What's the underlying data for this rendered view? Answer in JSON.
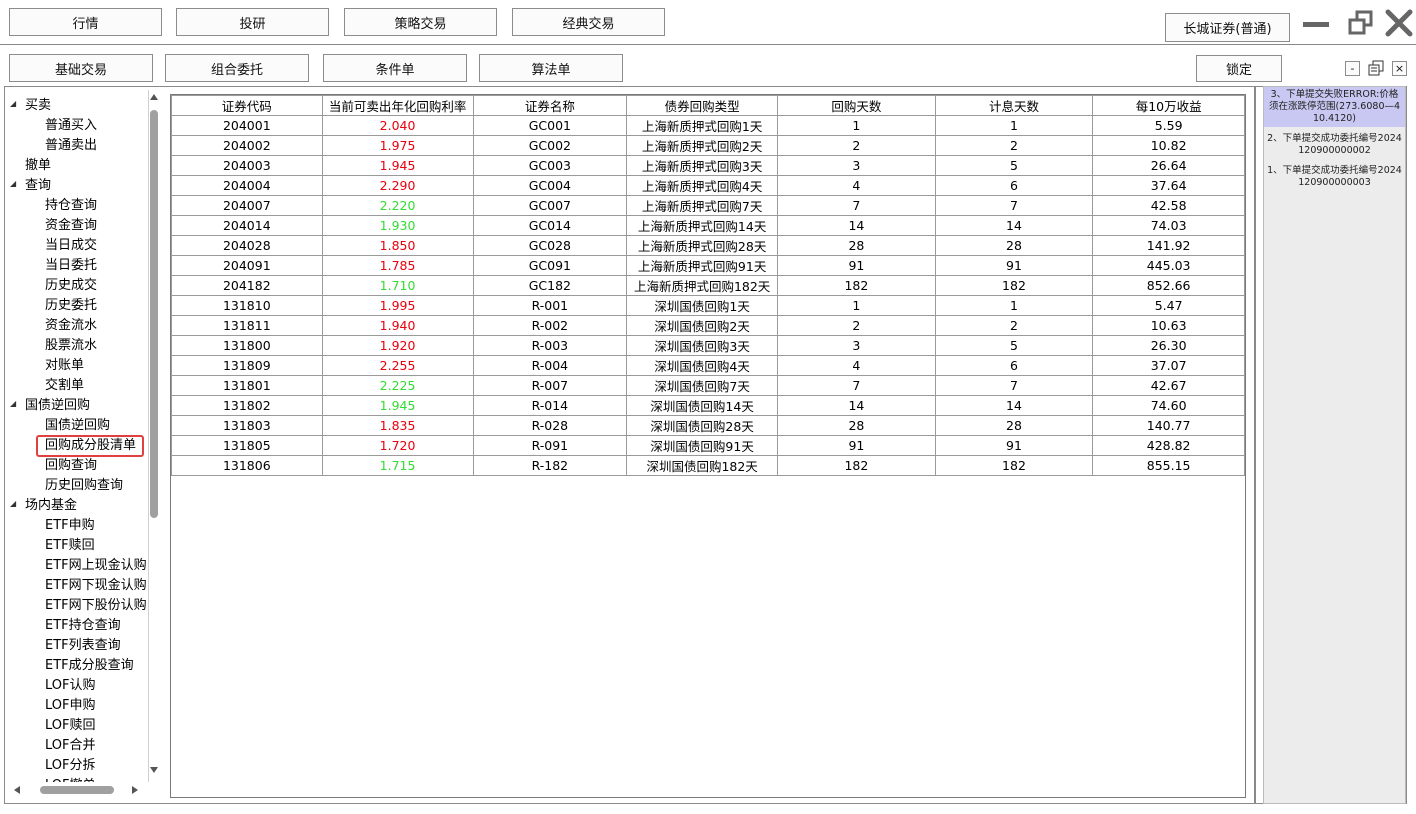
{
  "top_tabs": [
    "行情",
    "投研",
    "策略交易",
    "经典交易"
  ],
  "broker": "长城证券(普通)",
  "sub_tabs": [
    "基础交易",
    "组合委托",
    "条件单",
    "算法单"
  ],
  "lock_label": "锁定",
  "panel_controls": [
    "-",
    "×"
  ],
  "tree": [
    {
      "label": "买卖",
      "level": 0,
      "expanded": true
    },
    {
      "label": "普通买入",
      "level": 1
    },
    {
      "label": "普通卖出",
      "level": 1
    },
    {
      "label": "撤单",
      "level": 0
    },
    {
      "label": "查询",
      "level": 0,
      "expanded": true
    },
    {
      "label": "持仓查询",
      "level": 1
    },
    {
      "label": "资金查询",
      "level": 1
    },
    {
      "label": "当日成交",
      "level": 1
    },
    {
      "label": "当日委托",
      "level": 1
    },
    {
      "label": "历史成交",
      "level": 1
    },
    {
      "label": "历史委托",
      "level": 1
    },
    {
      "label": "资金流水",
      "level": 1
    },
    {
      "label": "股票流水",
      "level": 1
    },
    {
      "label": "对账单",
      "level": 1
    },
    {
      "label": "交割单",
      "level": 1
    },
    {
      "label": "国债逆回购",
      "level": 0,
      "expanded": true
    },
    {
      "label": "国债逆回购",
      "level": 1
    },
    {
      "label": "回购成分股清单",
      "level": 1,
      "selected": true
    },
    {
      "label": "回购查询",
      "level": 1
    },
    {
      "label": "历史回购查询",
      "level": 1
    },
    {
      "label": "场内基金",
      "level": 0,
      "expanded": true
    },
    {
      "label": "ETF申购",
      "level": 1
    },
    {
      "label": "ETF赎回",
      "level": 1
    },
    {
      "label": "ETF网上现金认购",
      "level": 1
    },
    {
      "label": "ETF网下现金认购",
      "level": 1
    },
    {
      "label": "ETF网下股份认购",
      "level": 1
    },
    {
      "label": "ETF持仓查询",
      "level": 1
    },
    {
      "label": "ETF列表查询",
      "level": 1
    },
    {
      "label": "ETF成分股查询",
      "level": 1
    },
    {
      "label": "LOF认购",
      "level": 1
    },
    {
      "label": "LOF申购",
      "level": 1
    },
    {
      "label": "LOF赎回",
      "level": 1
    },
    {
      "label": "LOF合并",
      "level": 1
    },
    {
      "label": "LOF分拆",
      "level": 1
    },
    {
      "label": "LOF撤单",
      "level": 1
    }
  ],
  "table": {
    "headers": [
      "证券代码",
      "当前可卖出年化回购利率",
      "证券名称",
      "债券回购类型",
      "回购天数",
      "计息天数",
      "每10万收益"
    ],
    "rows": [
      {
        "code": "204001",
        "rate": "2.040",
        "rate_color": "red",
        "name": "GC001",
        "type": "上海新质押式回购1天",
        "days": "1",
        "interest_days": "1",
        "income": "5.59"
      },
      {
        "code": "204002",
        "rate": "1.975",
        "rate_color": "red",
        "name": "GC002",
        "type": "上海新质押式回购2天",
        "days": "2",
        "interest_days": "2",
        "income": "10.82"
      },
      {
        "code": "204003",
        "rate": "1.945",
        "rate_color": "red",
        "name": "GC003",
        "type": "上海新质押式回购3天",
        "days": "3",
        "interest_days": "5",
        "income": "26.64"
      },
      {
        "code": "204004",
        "rate": "2.290",
        "rate_color": "red",
        "name": "GC004",
        "type": "上海新质押式回购4天",
        "days": "4",
        "interest_days": "6",
        "income": "37.64"
      },
      {
        "code": "204007",
        "rate": "2.220",
        "rate_color": "green",
        "name": "GC007",
        "type": "上海新质押式回购7天",
        "days": "7",
        "interest_days": "7",
        "income": "42.58"
      },
      {
        "code": "204014",
        "rate": "1.930",
        "rate_color": "green",
        "name": "GC014",
        "type": "上海新质押式回购14天",
        "days": "14",
        "interest_days": "14",
        "income": "74.03"
      },
      {
        "code": "204028",
        "rate": "1.850",
        "rate_color": "red",
        "name": "GC028",
        "type": "上海新质押式回购28天",
        "days": "28",
        "interest_days": "28",
        "income": "141.92"
      },
      {
        "code": "204091",
        "rate": "1.785",
        "rate_color": "red",
        "name": "GC091",
        "type": "上海新质押式回购91天",
        "days": "91",
        "interest_days": "91",
        "income": "445.03"
      },
      {
        "code": "204182",
        "rate": "1.710",
        "rate_color": "green",
        "name": "GC182",
        "type": "上海新质押式回购182天",
        "days": "182",
        "interest_days": "182",
        "income": "852.66"
      },
      {
        "code": "131810",
        "rate": "1.995",
        "rate_color": "red",
        "name": "R-001",
        "type": "深圳国债回购1天",
        "days": "1",
        "interest_days": "1",
        "income": "5.47"
      },
      {
        "code": "131811",
        "rate": "1.940",
        "rate_color": "red",
        "name": "R-002",
        "type": "深圳国债回购2天",
        "days": "2",
        "interest_days": "2",
        "income": "10.63"
      },
      {
        "code": "131800",
        "rate": "1.920",
        "rate_color": "red",
        "name": "R-003",
        "type": "深圳国债回购3天",
        "days": "3",
        "interest_days": "5",
        "income": "26.30"
      },
      {
        "code": "131809",
        "rate": "2.255",
        "rate_color": "red",
        "name": "R-004",
        "type": "深圳国债回购4天",
        "days": "4",
        "interest_days": "6",
        "income": "37.07"
      },
      {
        "code": "131801",
        "rate": "2.225",
        "rate_color": "green",
        "name": "R-007",
        "type": "深圳国债回购7天",
        "days": "7",
        "interest_days": "7",
        "income": "42.67"
      },
      {
        "code": "131802",
        "rate": "1.945",
        "rate_color": "green",
        "name": "R-014",
        "type": "深圳国债回购14天",
        "days": "14",
        "interest_days": "14",
        "income": "74.60"
      },
      {
        "code": "131803",
        "rate": "1.835",
        "rate_color": "red",
        "name": "R-028",
        "type": "深圳国债回购28天",
        "days": "28",
        "interest_days": "28",
        "income": "140.77"
      },
      {
        "code": "131805",
        "rate": "1.720",
        "rate_color": "red",
        "name": "R-091",
        "type": "深圳国债回购91天",
        "days": "91",
        "interest_days": "91",
        "income": "428.82"
      },
      {
        "code": "131806",
        "rate": "1.715",
        "rate_color": "green",
        "name": "R-182",
        "type": "深圳国债回购182天",
        "days": "182",
        "interest_days": "182",
        "income": "855.15"
      }
    ]
  },
  "log": [
    {
      "text": "3、下单提交失败ERROR:价格须在涨跌停范围(273.6080—410.4120)",
      "error": true
    },
    {
      "text": "2、下单提交成功委托编号2024120900000002",
      "error": false
    },
    {
      "text": "1、下单提交成功委托编号2024120900000003",
      "error": false
    }
  ],
  "colors": {
    "rate_red": "#e8000d",
    "rate_green": "#33dd33",
    "selected_border": "#e04040",
    "error_bg": "#c8c8f2"
  }
}
